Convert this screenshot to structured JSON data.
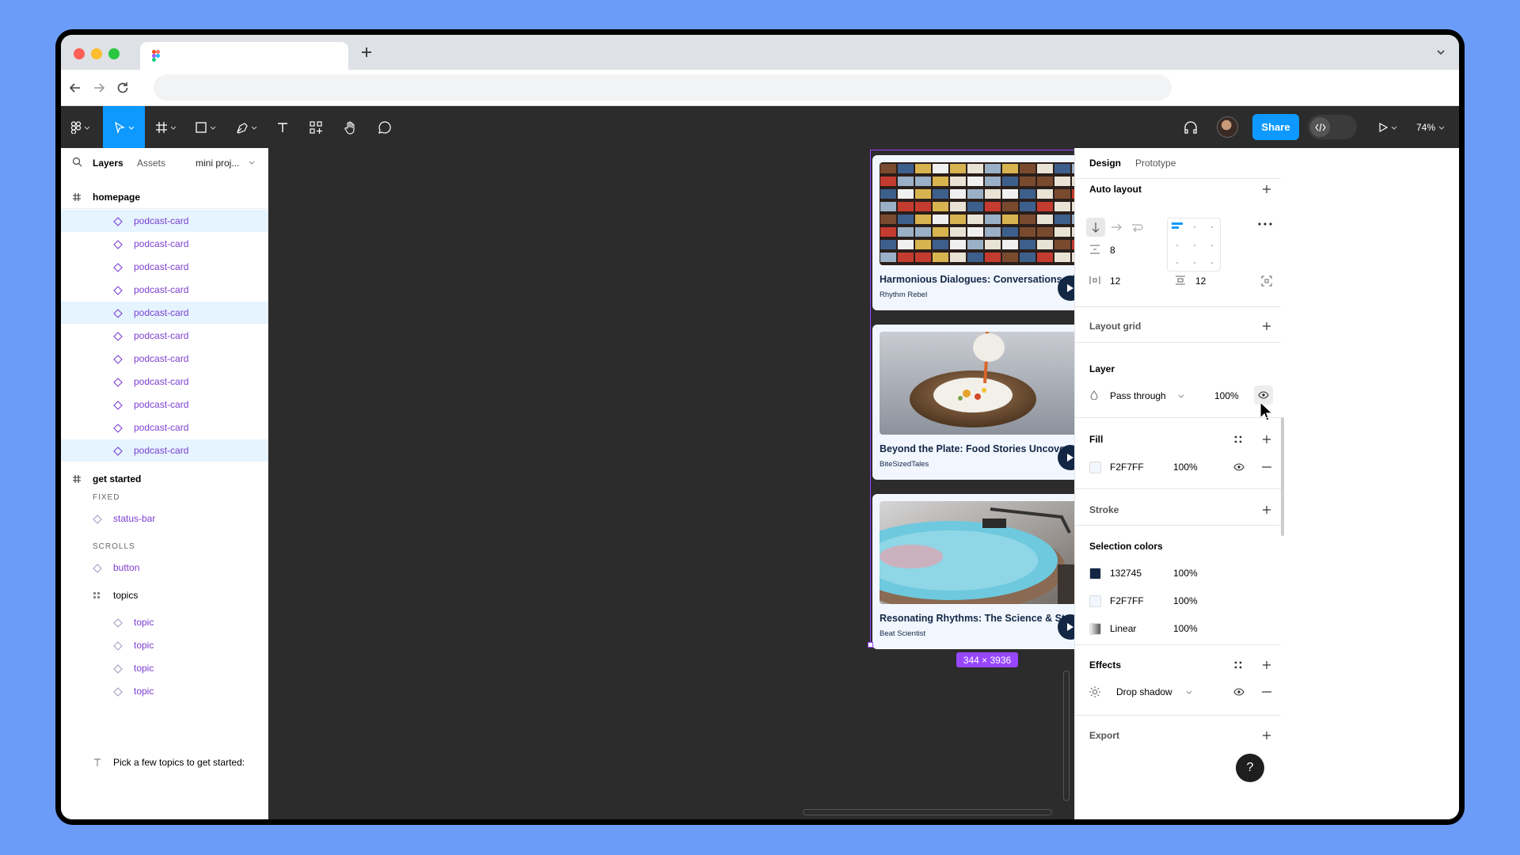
{
  "browser": {
    "new_tab": "+"
  },
  "toolbar": {
    "share_label": "Share",
    "zoom_label": "74%"
  },
  "layers_panel": {
    "tabs": {
      "layers": "Layers",
      "assets": "Assets",
      "page": "mini proj..."
    },
    "frames": {
      "homepage": "homepage",
      "get_started": "get started"
    },
    "homepage_items": [
      {
        "label": "podcast-card",
        "selected": true
      },
      {
        "label": "podcast-card",
        "selected": false
      },
      {
        "label": "podcast-card",
        "selected": false
      },
      {
        "label": "podcast-card",
        "selected": false
      },
      {
        "label": "podcast-card",
        "selected": true
      },
      {
        "label": "podcast-card",
        "selected": false
      },
      {
        "label": "podcast-card",
        "selected": false
      },
      {
        "label": "podcast-card",
        "selected": false
      },
      {
        "label": "podcast-card",
        "selected": false
      },
      {
        "label": "podcast-card",
        "selected": false
      },
      {
        "label": "podcast-card",
        "selected": true
      }
    ],
    "get_started": {
      "fixed_label": "FIXED",
      "status_bar": "status-bar",
      "scrolls_label": "SCROLLS",
      "button": "button",
      "topics": "topics",
      "topic_items": [
        "topic",
        "topic",
        "topic",
        "topic"
      ],
      "text_layer": "Pick a few topics to get started:"
    }
  },
  "canvas": {
    "cards": [
      {
        "title": "Harmonious Dialogues: Conversations with...",
        "author": "Rhythm Rebel",
        "thumb": "cassettes"
      },
      {
        "title": "Beyond the Plate: Food Stories Uncovered",
        "author": "BiteSizedTales",
        "thumb": "food"
      },
      {
        "title": "Resonating Rhythms: The Science & Stories...",
        "author": "Beat Scientist",
        "thumb": "vinyl"
      }
    ],
    "size_badge": "344 × 3936"
  },
  "design_panel": {
    "tabs": {
      "design": "Design",
      "prototype": "Prototype"
    },
    "auto_layout": {
      "title": "Auto layout",
      "gap": "8",
      "padding_h": "12",
      "padding_v": "12"
    },
    "layout_grid": {
      "title": "Layout grid"
    },
    "layer": {
      "title": "Layer",
      "blend": "Pass through",
      "opacity": "100%"
    },
    "fill": {
      "title": "Fill",
      "hex": "F2F7FF",
      "opacity": "100%",
      "color": "#F2F7FF"
    },
    "stroke": {
      "title": "Stroke"
    },
    "selection_colors": {
      "title": "Selection colors",
      "items": [
        {
          "hex": "132745",
          "opacity": "100%",
          "color": "#132745"
        },
        {
          "hex": "F2F7FF",
          "opacity": "100%",
          "color": "#F2F7FF"
        },
        {
          "hex": "Linear",
          "opacity": "100%",
          "color": "linear"
        }
      ]
    },
    "effects": {
      "title": "Effects",
      "effect": "Drop shadow"
    },
    "export": {
      "title": "Export"
    },
    "help": "?"
  },
  "colors": {
    "accent": "#0d99ff",
    "component": "#9747ff",
    "toolbar_bg": "#2c2c2c",
    "canvas_bg": "#2c2c2c",
    "card_bg": "#F2F7FF",
    "card_text": "#132745"
  }
}
